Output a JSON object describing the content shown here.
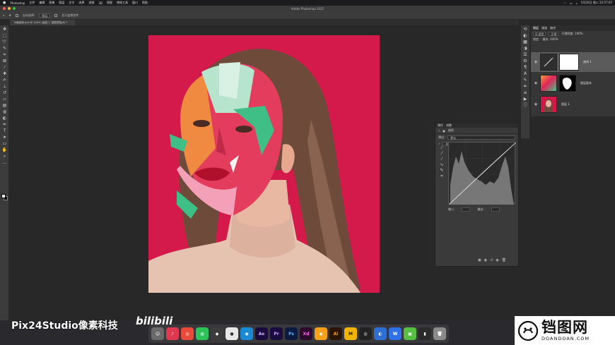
{
  "menubar": {
    "apple": "",
    "items": [
      "Photoshop",
      "文件",
      "编辑",
      "图像",
      "图层",
      "文字",
      "选择",
      "滤镜",
      "3D",
      "视图",
      "增效工具",
      "窗口",
      "帮助"
    ],
    "clock": "5月20日 周二 22:57:07"
  },
  "window": {
    "title": "Adobe Photoshop 2021"
  },
  "options": {
    "auto_select": "自动选择:",
    "layer_select": "图层",
    "show_transform": "显示变换控件"
  },
  "document": {
    "tab_label": "※面绘制.psd @ 100% (曲线 1, 图层蒙版/8) *"
  },
  "layers": {
    "tabs": [
      "图层",
      "通道",
      "路径"
    ],
    "kind": "Q 类型",
    "mode": "正常",
    "opacity_label": "不透明度: 100%",
    "lock_label": "锁定:",
    "fill_label": "填充: 100%",
    "items": [
      {
        "name": "曲线 1",
        "selected": true
      },
      {
        "name": "图层副本",
        "selected": false
      },
      {
        "name": "图层 1",
        "selected": false
      }
    ]
  },
  "properties": {
    "tabs": [
      "属性",
      "调整"
    ],
    "title": "曲线",
    "preset_label": "预设:",
    "preset_value": "默认",
    "channel": "RGB",
    "auto": "自动",
    "input_label": "输入:",
    "output_label": "输出:"
  },
  "dock": {
    "apps": [
      {
        "name": "Ae",
        "color": "#1a0b3e",
        "fg": "#c8a8ff"
      },
      {
        "name": "Pr",
        "color": "#1a0b3e",
        "fg": "#c8a8ff"
      },
      {
        "name": "Ps",
        "color": "#0b1a3e",
        "fg": "#4fb8ff"
      },
      {
        "name": "Xd",
        "color": "#2b0a2b",
        "fg": "#ff61f6"
      },
      {
        "name": "Ai",
        "color": "#2b1400",
        "fg": "#ff9a00"
      },
      {
        "name": "M",
        "color": "#f2b400",
        "fg": "#2a1a00"
      }
    ]
  },
  "watermark": {
    "left": "Pix24Studio像素科技",
    "bilibili": "bilibili",
    "right_cn": "铛图网",
    "right_en": "DOANDOAN.COM"
  },
  "colors": {
    "canvas_bg": "#d41848",
    "panel_bg": "#363636"
  }
}
